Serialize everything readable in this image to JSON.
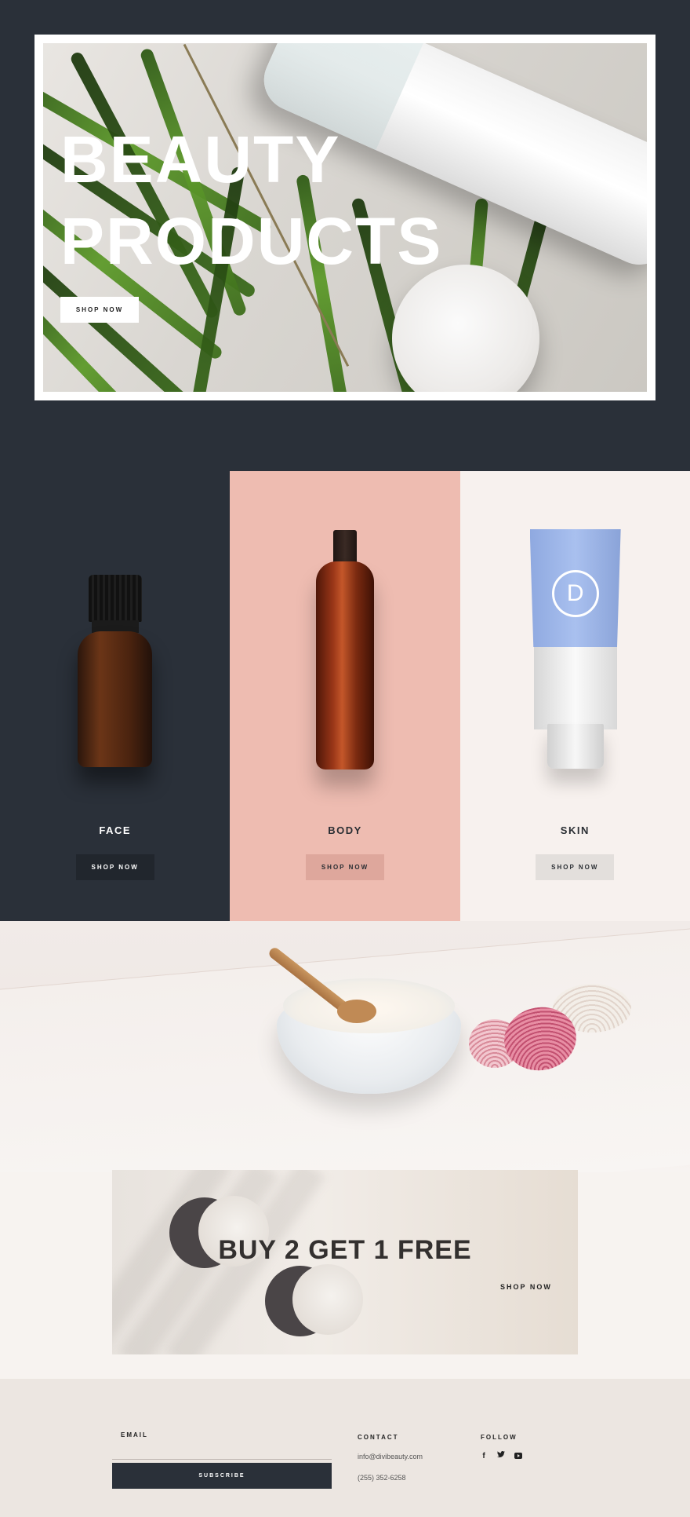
{
  "hero": {
    "title_line1": "BEAUTY",
    "title_line2": "PRODUCTS",
    "button_label": "SHOP NOW"
  },
  "categories": [
    {
      "label": "FACE",
      "button_label": "SHOP NOW",
      "color": "#2a3039"
    },
    {
      "label": "BODY",
      "button_label": "SHOP NOW",
      "color": "#eebcb1"
    },
    {
      "label": "SKIN",
      "button_label": "SHOP NOW",
      "color": "#f7f1ee"
    }
  ],
  "skin_logo_letter": "D",
  "promo": {
    "title": "BUY 2 GET 1 FREE",
    "link_label": "SHOP NOW"
  },
  "footer": {
    "email_label": "EMAIL",
    "email_value": "",
    "subscribe_label": "SUBSCRIBE",
    "contact_heading": "CONTACT",
    "contact_email": "info@divibeauty.com",
    "contact_phone": "(255) 352-6258",
    "follow_heading": "FOLLOW",
    "social": [
      "facebook-icon",
      "twitter-icon",
      "youtube-icon"
    ]
  },
  "colors": {
    "dark": "#2a3039",
    "pink": "#eebcb1",
    "cream": "#f7f1ee",
    "footer_bg": "#ece6e1"
  }
}
